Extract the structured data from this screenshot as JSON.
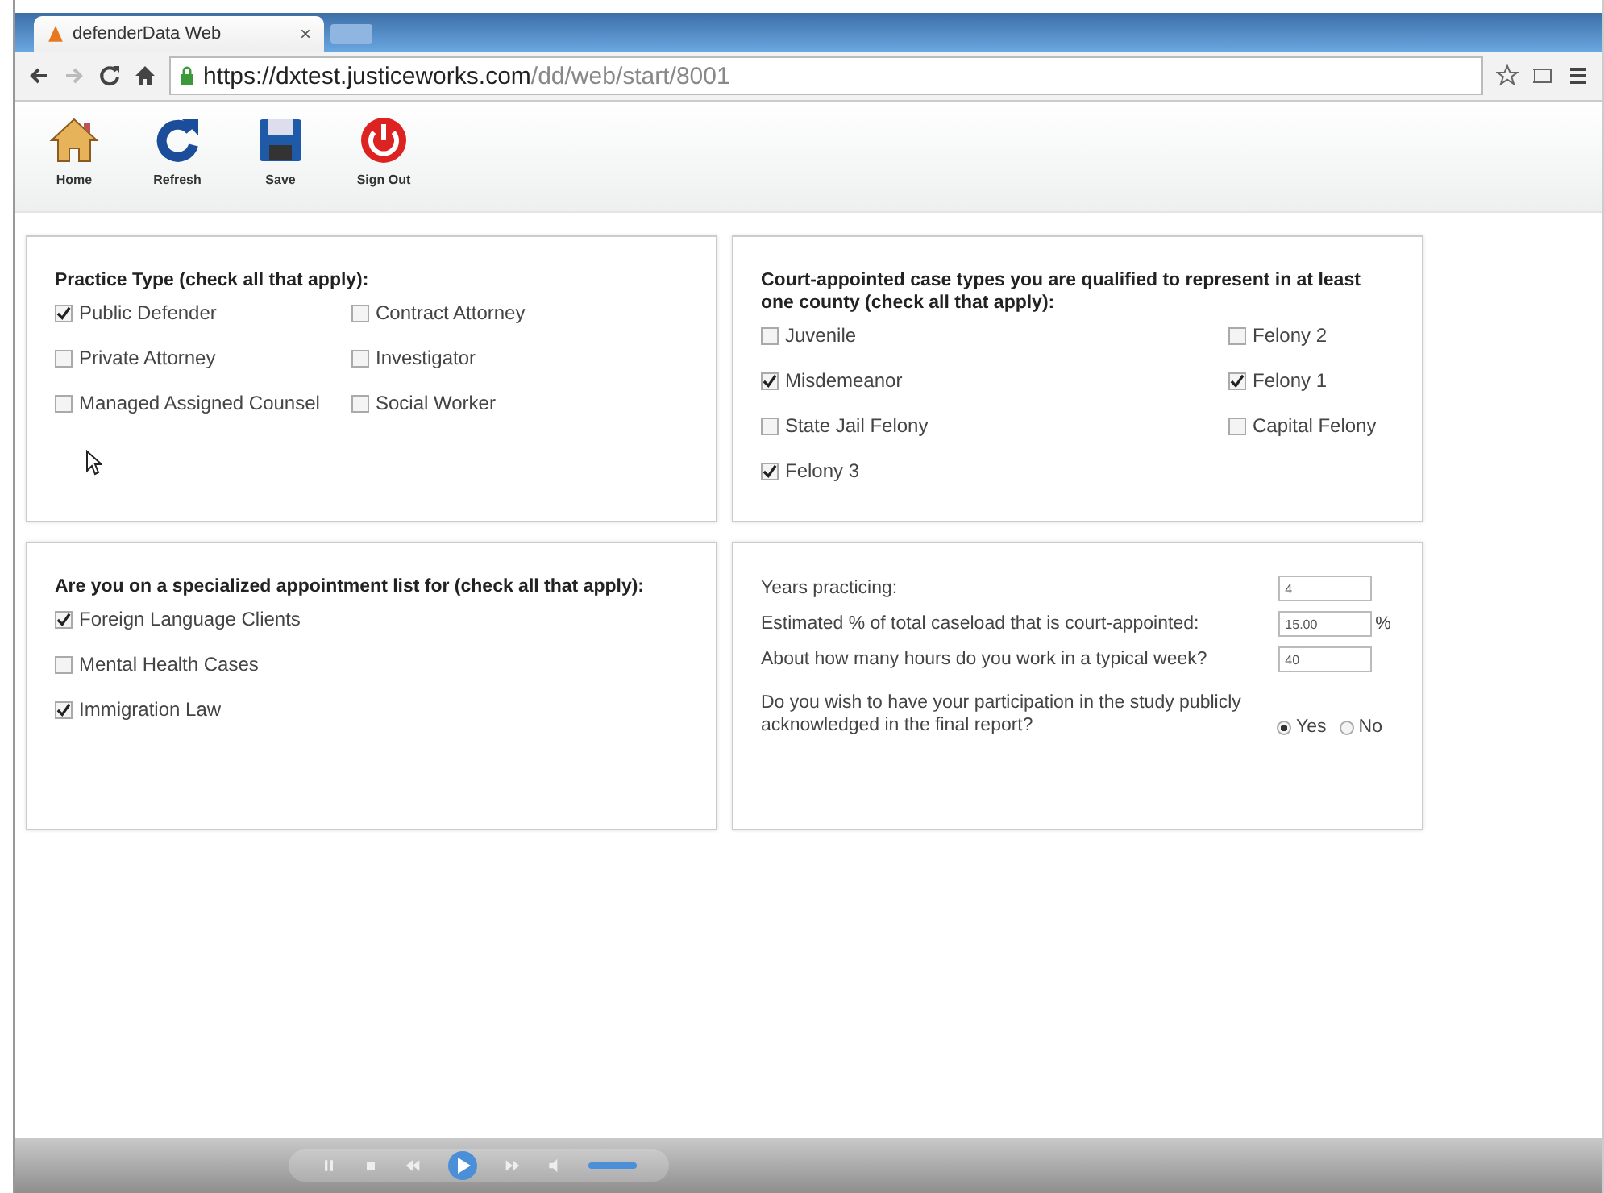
{
  "browser": {
    "tab_title": "defenderData Web",
    "tab_close": "×",
    "url_host": "https://dxtest.justiceworks.com",
    "url_path": "/dd/web/start/8001"
  },
  "toolbar": [
    {
      "kind": "home",
      "label": "Home"
    },
    {
      "kind": "refresh",
      "label": "Refresh"
    },
    {
      "kind": "save",
      "label": "Save"
    },
    {
      "kind": "signout",
      "label": "Sign Out"
    }
  ],
  "practice_type": {
    "title": "Practice Type (check all that apply):",
    "options": [
      {
        "label": "Public Defender",
        "checked": true
      },
      {
        "label": "Contract Attorney",
        "checked": false
      },
      {
        "label": "Private Attorney",
        "checked": false
      },
      {
        "label": "Investigator",
        "checked": false
      },
      {
        "label": "Managed Assigned Counsel",
        "checked": false
      },
      {
        "label": "Social Worker",
        "checked": false
      }
    ]
  },
  "case_types": {
    "title": "Court-appointed case types you are qualified to represent in at least one county (check all that apply):",
    "options": [
      {
        "label": "Juvenile",
        "checked": false
      },
      {
        "label": "Felony 2",
        "checked": false
      },
      {
        "label": "Misdemeanor",
        "checked": true
      },
      {
        "label": "Felony 1",
        "checked": true
      },
      {
        "label": "State Jail Felony",
        "checked": false
      },
      {
        "label": "Capital Felony",
        "checked": false
      },
      {
        "label": "Felony 3",
        "checked": true
      }
    ]
  },
  "special_lists": {
    "title": "Are you on a specialized appointment list for (check all that apply):",
    "options": [
      {
        "label": "Foreign Language Clients",
        "checked": true
      },
      {
        "label": "Mental Health Cases",
        "checked": false
      },
      {
        "label": "Immigration Law",
        "checked": true
      }
    ]
  },
  "details": {
    "fields": [
      {
        "label": "Years practicing:",
        "value": "4"
      },
      {
        "label": "Estimated % of total caseload that is court-appointed:",
        "value": "15.00",
        "suffix": "%"
      },
      {
        "label": "About how many hours do you work in a typical week?",
        "value": "40"
      }
    ],
    "acknowledge": {
      "label": "Do you wish to have your participation in the study publicly acknowledged in the final report?",
      "options": [
        {
          "label": "Yes",
          "selected": true
        },
        {
          "label": "No",
          "selected": false
        }
      ]
    }
  }
}
